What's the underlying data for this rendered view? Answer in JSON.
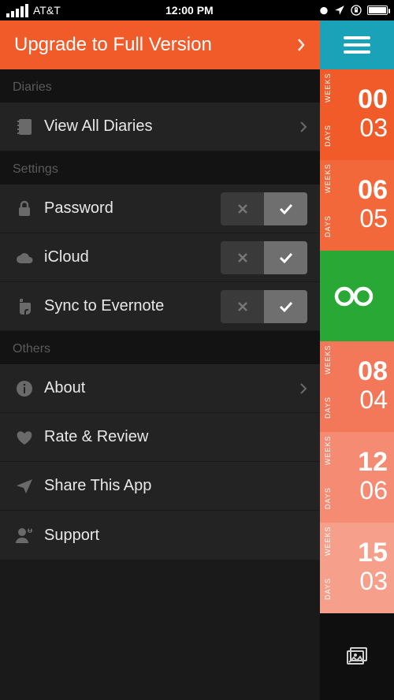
{
  "status": {
    "carrier": "AT&T",
    "time": "12:00 PM"
  },
  "upgrade": {
    "label": "Upgrade to Full Version"
  },
  "sections": {
    "diaries": {
      "title": "Diaries",
      "view_all": "View All Diaries"
    },
    "settings": {
      "title": "Settings",
      "password": "Password",
      "icloud": "iCloud",
      "evernote": "Sync to Evernote"
    },
    "others": {
      "title": "Others",
      "about": "About",
      "rate": "Rate & Review",
      "share": "Share This App",
      "support": "Support"
    }
  },
  "toggles": {
    "password": "on",
    "icloud": "on",
    "evernote": "on"
  },
  "rail": {
    "tiles": [
      {
        "weeks": "00",
        "days": "03",
        "color": "#f15a29"
      },
      {
        "weeks": "06",
        "days": "05",
        "color": "#f2683b"
      },
      {
        "type": "infinity",
        "color": "#2aa836"
      },
      {
        "weeks": "08",
        "days": "04",
        "color": "#f3785a"
      },
      {
        "weeks": "12",
        "days": "06",
        "color": "#f58b72"
      },
      {
        "weeks": "15",
        "days": "03",
        "color": "#f6a08b"
      }
    ],
    "labels": {
      "weeks": "WEEKS",
      "days": "DAYS"
    }
  },
  "colors": {
    "accent": "#f15a29",
    "railTop": "#1aa3b8",
    "green": "#2aa836"
  }
}
